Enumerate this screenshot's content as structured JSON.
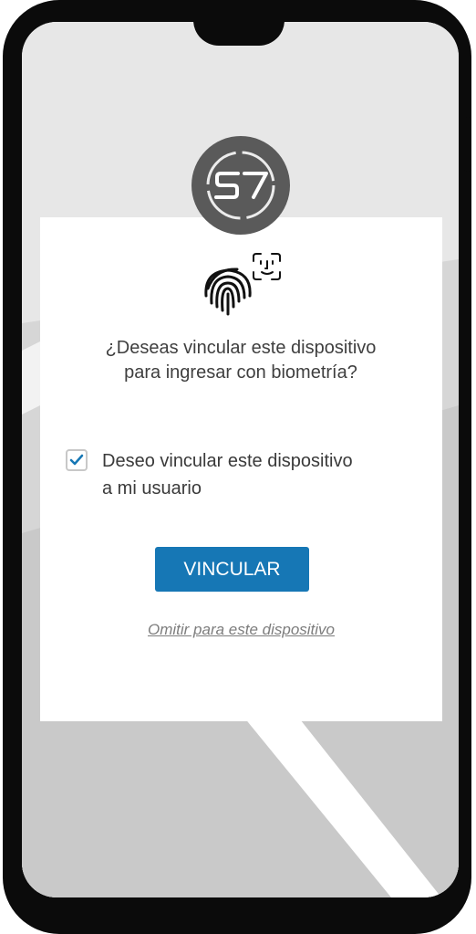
{
  "logo": {
    "text": "S7"
  },
  "dialog": {
    "question_line1": "¿Deseas vincular este dispositivo",
    "question_line2": "para ingresar con biometría?",
    "checkbox": {
      "checked": true,
      "label_line1": "Deseo vincular este dispositivo",
      "label_line2": "a mi usuario"
    },
    "primary_button": "VINCULAR",
    "skip_link": "Omitir para este dispositivo"
  },
  "icons": {
    "biometric": [
      "fingerprint-icon",
      "face-id-icon"
    ],
    "checkbox": "checkmark-icon"
  },
  "colors": {
    "accent": "#1677b5",
    "logo_bg": "#5a5a5a",
    "phone_frame": "#0b0b0b",
    "text": "#3f3f3f",
    "link": "#7d7d7d"
  }
}
